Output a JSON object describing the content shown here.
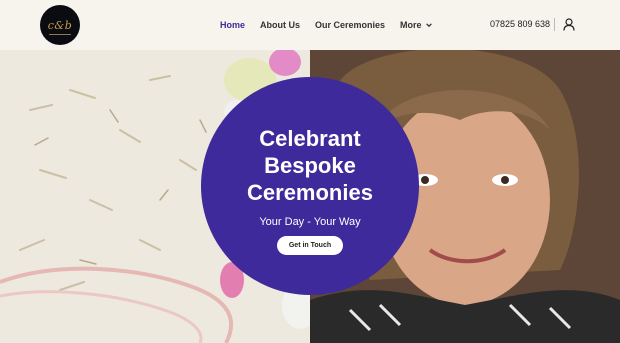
{
  "brand": {
    "logo_text": "c&b",
    "logo_alt": "site logo"
  },
  "nav": {
    "items": [
      {
        "label": "Home",
        "active": true
      },
      {
        "label": "About Us",
        "active": false
      },
      {
        "label": "Our Ceremonies",
        "active": false
      },
      {
        "label": "More",
        "active": false
      }
    ]
  },
  "contact": {
    "phone": "07825 809 638"
  },
  "hero": {
    "title_lines": [
      "Celebrant",
      "Bespoke",
      "Ceremonies"
    ],
    "tagline": "Your Day - Your Way",
    "cta_label": "Get in Touch"
  },
  "colors": {
    "accent": "#3f2a9b",
    "header_bg": "#f7f4ee"
  }
}
